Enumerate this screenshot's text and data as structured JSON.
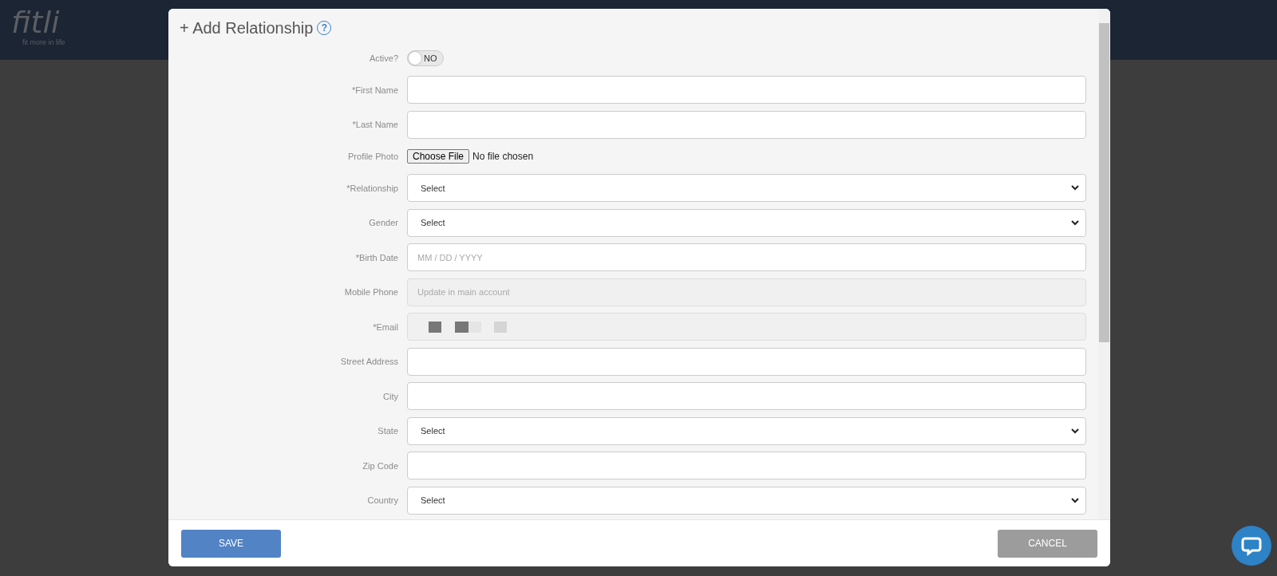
{
  "brand": {
    "logo": "fitli",
    "tagline": "fit more in life"
  },
  "modal": {
    "title": "+ Add Relationship",
    "help": "?"
  },
  "fields": [
    {
      "kind": "toggle",
      "label": "Active?",
      "on": false,
      "off_text": "NO"
    },
    {
      "kind": "text",
      "label": "*First Name"
    },
    {
      "kind": "text",
      "label": "*Last Name"
    },
    {
      "kind": "file",
      "label": "Profile Photo",
      "button": "Choose File",
      "status": "No file chosen"
    },
    {
      "kind": "select",
      "label": "*Relationship",
      "value": "Select"
    },
    {
      "kind": "select",
      "label": "Gender",
      "value": "Select"
    },
    {
      "kind": "text",
      "label": "*Birth Date",
      "placeholder": "MM / DD / YYYY"
    },
    {
      "kind": "text",
      "label": "Mobile Phone",
      "placeholder": "Update in main account",
      "disabled": true
    },
    {
      "kind": "redacted",
      "label": "*Email",
      "disabled": true
    },
    {
      "kind": "text",
      "label": "Street Address"
    },
    {
      "kind": "text",
      "label": "City"
    },
    {
      "kind": "select",
      "label": "State",
      "value": "Select"
    },
    {
      "kind": "text",
      "label": "Zip Code"
    },
    {
      "kind": "select",
      "label": "Country",
      "value": "Select"
    }
  ],
  "buttons": {
    "save": "SAVE",
    "cancel": "CANCEL"
  }
}
